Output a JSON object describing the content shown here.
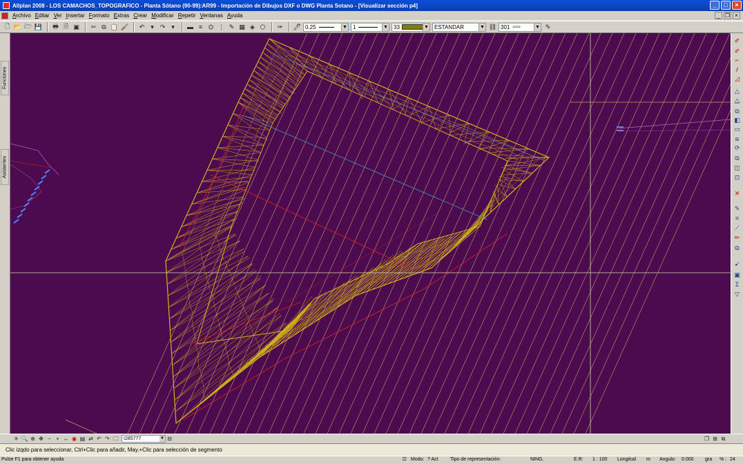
{
  "window": {
    "title": "Allplan 2008 - LOS CAMACHOS_TOPOGRAFICO - Planta Sótano (90-99):AR99 - Importación de Dibujos DXF o DWG Planta Sotano - [Visualizar sección p4]",
    "minimize": "_",
    "maximize": "□",
    "close": "×"
  },
  "menu": {
    "items": [
      {
        "u": "A",
        "rest": "rchivo"
      },
      {
        "u": "E",
        "rest": "ditar"
      },
      {
        "u": "V",
        "rest": "er"
      },
      {
        "u": "I",
        "rest": "nsertar"
      },
      {
        "u": "F",
        "rest": "ormato"
      },
      {
        "u": "E",
        "rest": "xtras"
      },
      {
        "u": "C",
        "rest": "rear"
      },
      {
        "u": "M",
        "rest": "odificar"
      },
      {
        "u": "R",
        "rest": "epetir"
      },
      {
        "u": "V",
        "rest": "entanas"
      },
      {
        "u": "A",
        "rest": "yuda"
      }
    ]
  },
  "toolbar": {
    "pen_thickness": "0.25",
    "line_type": "1",
    "color_number": "33",
    "color_swatch": "#808000",
    "layer": "ESTANDAR",
    "hatch_number": "301"
  },
  "left_tabs": {
    "funciones": "Funciones",
    "asistentes": "Asistentes"
  },
  "canvas": {
    "background": "#4c0b4f",
    "mesh_color": "#d4b21a",
    "hatch_color": "#c8a060",
    "red_line": "#e02020",
    "cyan_line": "#40a0c0",
    "crosshair": "#d8d8a8"
  },
  "viewbar": {
    "zoom_value": "I285777"
  },
  "prompt": {
    "text": "Clic izqdo para seleccionar, Ctrl+Clic para añadir, May.+Clic para selección de segmento"
  },
  "status": {
    "help": "Pulse F1 para obtener ayuda",
    "mode_label": "Modo:",
    "mode_value": "? Act",
    "repr_label": "Tipo de representación:",
    "ning": "NING.",
    "er_label": "E.R:",
    "er_value": "1 : 100",
    "length_label": "Longitud",
    "length_unit": "m",
    "angle_label": "Angulo:",
    "angle_value": "0.000",
    "angle_unit": "gra",
    "pct_label": "% :",
    "pct_value": "24"
  }
}
